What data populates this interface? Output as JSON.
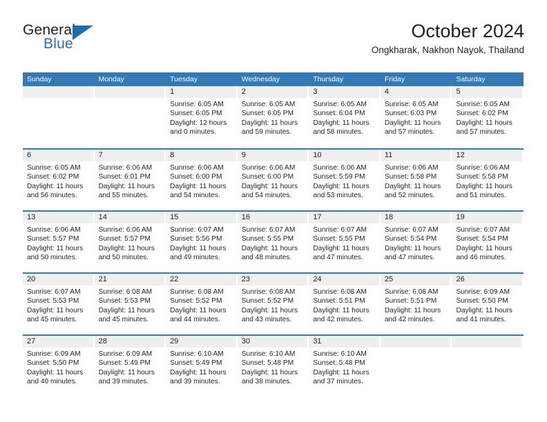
{
  "brand": {
    "word1": "General",
    "word2": "Blue",
    "logo_icon": "triangle-logo-icon",
    "accent_color": "#2272b4"
  },
  "header": {
    "title": "October 2024",
    "subtitle": "Ongkharak, Nakhon Nayok, Thailand"
  },
  "calendar": {
    "header_bg_color": "#3479b5",
    "daynum_bg_color": "#efefef",
    "weekday_headers": [
      "Sunday",
      "Monday",
      "Tuesday",
      "Wednesday",
      "Thursday",
      "Friday",
      "Saturday"
    ],
    "weeks": [
      [
        {
          "day": "",
          "sunrise": "",
          "sunset": "",
          "daylight1": "",
          "daylight2": ""
        },
        {
          "day": "",
          "sunrise": "",
          "sunset": "",
          "daylight1": "",
          "daylight2": ""
        },
        {
          "day": "1",
          "sunrise": "Sunrise: 6:05 AM",
          "sunset": "Sunset: 6:05 PM",
          "daylight1": "Daylight: 12 hours",
          "daylight2": "and 0 minutes."
        },
        {
          "day": "2",
          "sunrise": "Sunrise: 6:05 AM",
          "sunset": "Sunset: 6:05 PM",
          "daylight1": "Daylight: 11 hours",
          "daylight2": "and 59 minutes."
        },
        {
          "day": "3",
          "sunrise": "Sunrise: 6:05 AM",
          "sunset": "Sunset: 6:04 PM",
          "daylight1": "Daylight: 11 hours",
          "daylight2": "and 58 minutes."
        },
        {
          "day": "4",
          "sunrise": "Sunrise: 6:05 AM",
          "sunset": "Sunset: 6:03 PM",
          "daylight1": "Daylight: 11 hours",
          "daylight2": "and 57 minutes."
        },
        {
          "day": "5",
          "sunrise": "Sunrise: 6:05 AM",
          "sunset": "Sunset: 6:02 PM",
          "daylight1": "Daylight: 11 hours",
          "daylight2": "and 57 minutes."
        }
      ],
      [
        {
          "day": "6",
          "sunrise": "Sunrise: 6:05 AM",
          "sunset": "Sunset: 6:02 PM",
          "daylight1": "Daylight: 11 hours",
          "daylight2": "and 56 minutes."
        },
        {
          "day": "7",
          "sunrise": "Sunrise: 6:06 AM",
          "sunset": "Sunset: 6:01 PM",
          "daylight1": "Daylight: 11 hours",
          "daylight2": "and 55 minutes."
        },
        {
          "day": "8",
          "sunrise": "Sunrise: 6:06 AM",
          "sunset": "Sunset: 6:00 PM",
          "daylight1": "Daylight: 11 hours",
          "daylight2": "and 54 minutes."
        },
        {
          "day": "9",
          "sunrise": "Sunrise: 6:06 AM",
          "sunset": "Sunset: 6:00 PM",
          "daylight1": "Daylight: 11 hours",
          "daylight2": "and 54 minutes."
        },
        {
          "day": "10",
          "sunrise": "Sunrise: 6:06 AM",
          "sunset": "Sunset: 5:59 PM",
          "daylight1": "Daylight: 11 hours",
          "daylight2": "and 53 minutes."
        },
        {
          "day": "11",
          "sunrise": "Sunrise: 6:06 AM",
          "sunset": "Sunset: 5:58 PM",
          "daylight1": "Daylight: 11 hours",
          "daylight2": "and 52 minutes."
        },
        {
          "day": "12",
          "sunrise": "Sunrise: 6:06 AM",
          "sunset": "Sunset: 5:58 PM",
          "daylight1": "Daylight: 11 hours",
          "daylight2": "and 51 minutes."
        }
      ],
      [
        {
          "day": "13",
          "sunrise": "Sunrise: 6:06 AM",
          "sunset": "Sunset: 5:57 PM",
          "daylight1": "Daylight: 11 hours",
          "daylight2": "and 50 minutes."
        },
        {
          "day": "14",
          "sunrise": "Sunrise: 6:06 AM",
          "sunset": "Sunset: 5:57 PM",
          "daylight1": "Daylight: 11 hours",
          "daylight2": "and 50 minutes."
        },
        {
          "day": "15",
          "sunrise": "Sunrise: 6:07 AM",
          "sunset": "Sunset: 5:56 PM",
          "daylight1": "Daylight: 11 hours",
          "daylight2": "and 49 minutes."
        },
        {
          "day": "16",
          "sunrise": "Sunrise: 6:07 AM",
          "sunset": "Sunset: 5:55 PM",
          "daylight1": "Daylight: 11 hours",
          "daylight2": "and 48 minutes."
        },
        {
          "day": "17",
          "sunrise": "Sunrise: 6:07 AM",
          "sunset": "Sunset: 5:55 PM",
          "daylight1": "Daylight: 11 hours",
          "daylight2": "and 47 minutes."
        },
        {
          "day": "18",
          "sunrise": "Sunrise: 6:07 AM",
          "sunset": "Sunset: 5:54 PM",
          "daylight1": "Daylight: 11 hours",
          "daylight2": "and 47 minutes."
        },
        {
          "day": "19",
          "sunrise": "Sunrise: 6:07 AM",
          "sunset": "Sunset: 5:54 PM",
          "daylight1": "Daylight: 11 hours",
          "daylight2": "and 46 minutes."
        }
      ],
      [
        {
          "day": "20",
          "sunrise": "Sunrise: 6:07 AM",
          "sunset": "Sunset: 5:53 PM",
          "daylight1": "Daylight: 11 hours",
          "daylight2": "and 45 minutes."
        },
        {
          "day": "21",
          "sunrise": "Sunrise: 6:08 AM",
          "sunset": "Sunset: 5:53 PM",
          "daylight1": "Daylight: 11 hours",
          "daylight2": "and 45 minutes."
        },
        {
          "day": "22",
          "sunrise": "Sunrise: 6:08 AM",
          "sunset": "Sunset: 5:52 PM",
          "daylight1": "Daylight: 11 hours",
          "daylight2": "and 44 minutes."
        },
        {
          "day": "23",
          "sunrise": "Sunrise: 6:08 AM",
          "sunset": "Sunset: 5:52 PM",
          "daylight1": "Daylight: 11 hours",
          "daylight2": "and 43 minutes."
        },
        {
          "day": "24",
          "sunrise": "Sunrise: 6:08 AM",
          "sunset": "Sunset: 5:51 PM",
          "daylight1": "Daylight: 11 hours",
          "daylight2": "and 42 minutes."
        },
        {
          "day": "25",
          "sunrise": "Sunrise: 6:08 AM",
          "sunset": "Sunset: 5:51 PM",
          "daylight1": "Daylight: 11 hours",
          "daylight2": "and 42 minutes."
        },
        {
          "day": "26",
          "sunrise": "Sunrise: 6:09 AM",
          "sunset": "Sunset: 5:50 PM",
          "daylight1": "Daylight: 11 hours",
          "daylight2": "and 41 minutes."
        }
      ],
      [
        {
          "day": "27",
          "sunrise": "Sunrise: 6:09 AM",
          "sunset": "Sunset: 5:50 PM",
          "daylight1": "Daylight: 11 hours",
          "daylight2": "and 40 minutes."
        },
        {
          "day": "28",
          "sunrise": "Sunrise: 6:09 AM",
          "sunset": "Sunset: 5:49 PM",
          "daylight1": "Daylight: 11 hours",
          "daylight2": "and 39 minutes."
        },
        {
          "day": "29",
          "sunrise": "Sunrise: 6:10 AM",
          "sunset": "Sunset: 5:49 PM",
          "daylight1": "Daylight: 11 hours",
          "daylight2": "and 39 minutes."
        },
        {
          "day": "30",
          "sunrise": "Sunrise: 6:10 AM",
          "sunset": "Sunset: 5:48 PM",
          "daylight1": "Daylight: 11 hours",
          "daylight2": "and 38 minutes."
        },
        {
          "day": "31",
          "sunrise": "Sunrise: 6:10 AM",
          "sunset": "Sunset: 5:48 PM",
          "daylight1": "Daylight: 11 hours",
          "daylight2": "and 37 minutes."
        },
        {
          "day": "",
          "sunrise": "",
          "sunset": "",
          "daylight1": "",
          "daylight2": ""
        },
        {
          "day": "",
          "sunrise": "",
          "sunset": "",
          "daylight1": "",
          "daylight2": ""
        }
      ]
    ]
  }
}
